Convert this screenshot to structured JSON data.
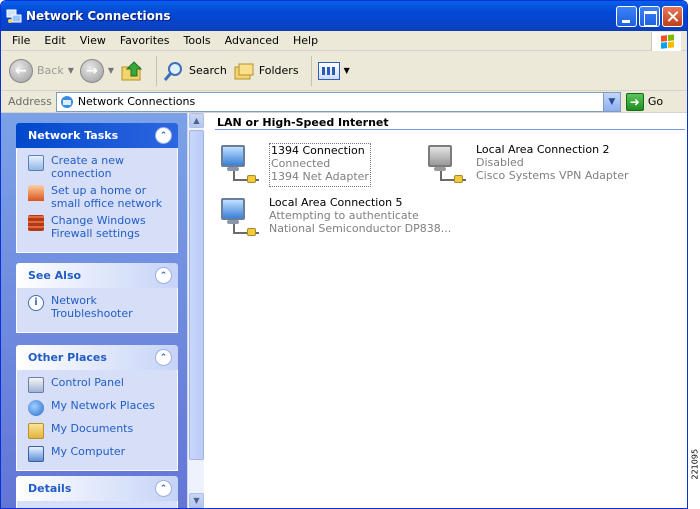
{
  "window": {
    "title": "Network Connections"
  },
  "menu": [
    "File",
    "Edit",
    "View",
    "Favorites",
    "Tools",
    "Advanced",
    "Help"
  ],
  "toolbar": {
    "back": "Back",
    "search": "Search",
    "folders": "Folders"
  },
  "address": {
    "label": "Address",
    "value": "Network Connections",
    "go": "Go"
  },
  "taskpane": {
    "network_tasks": {
      "title": "Network Tasks",
      "items": [
        {
          "label": "Create a new connection",
          "icon": "new-connection-icon"
        },
        {
          "label": "Set up a home or small office network",
          "icon": "home-network-icon"
        },
        {
          "label": "Change Windows Firewall settings",
          "icon": "firewall-icon"
        }
      ]
    },
    "see_also": {
      "title": "See Also",
      "items": [
        {
          "label": "Network Troubleshooter",
          "icon": "info-icon"
        }
      ]
    },
    "other_places": {
      "title": "Other Places",
      "items": [
        {
          "label": "Control Panel",
          "icon": "control-panel-icon"
        },
        {
          "label": "My Network Places",
          "icon": "network-places-icon"
        },
        {
          "label": "My Documents",
          "icon": "documents-folder-icon"
        },
        {
          "label": "My Computer",
          "icon": "computer-icon"
        }
      ]
    },
    "details": {
      "title": "Details"
    }
  },
  "content": {
    "group_header": "LAN or High-Speed Internet",
    "connections": [
      {
        "name": "1394 Connection",
        "status": "Connected",
        "device": "1394 Net Adapter",
        "state": "connected"
      },
      {
        "name": "Local Area Connection 2",
        "status": "Disabled",
        "device": "Cisco Systems VPN Adapter",
        "state": "disabled"
      },
      {
        "name": "Local Area Connection 5",
        "status": "Attempting to authenticate",
        "device": "National Semiconductor DP838...",
        "state": "connected"
      }
    ]
  },
  "figure_number": "221095",
  "colors": {
    "titlebar": "#0a4fd8",
    "taskpane_bg": "#7ba2e7",
    "link": "#215dc6",
    "group_line": "#7a96df"
  }
}
